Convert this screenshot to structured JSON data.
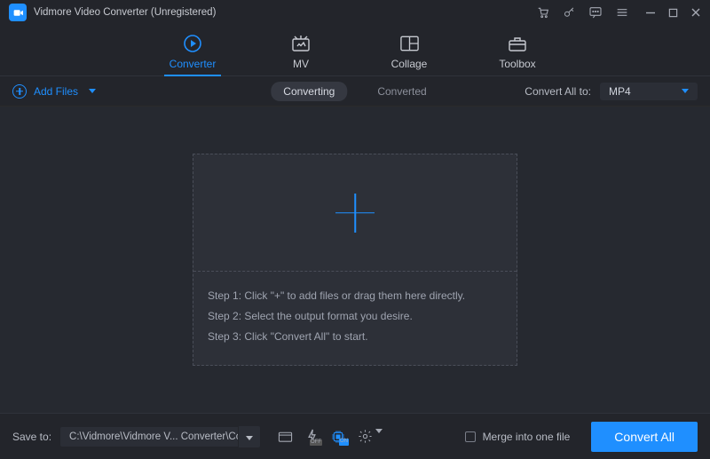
{
  "app": {
    "title": "Vidmore Video Converter (Unregistered)"
  },
  "nav": {
    "converter": "Converter",
    "mv": "MV",
    "collage": "Collage",
    "toolbox": "Toolbox"
  },
  "toolbar": {
    "add_files": "Add Files",
    "seg_converting": "Converting",
    "seg_converted": "Converted",
    "convert_all_to_label": "Convert All to:",
    "format_selected": "MP4"
  },
  "dropzone": {
    "step1": "Step 1: Click \"+\" to add files or drag them here directly.",
    "step2": "Step 2: Select the output format you desire.",
    "step3": "Step 3: Click \"Convert All\" to start."
  },
  "bottom": {
    "save_to_label": "Save to:",
    "path": "C:\\Vidmore\\Vidmore V... Converter\\Converted",
    "hw_off": "OFF",
    "hw_on": "ON",
    "merge_label": "Merge into one file",
    "convert_all_btn": "Convert All"
  }
}
